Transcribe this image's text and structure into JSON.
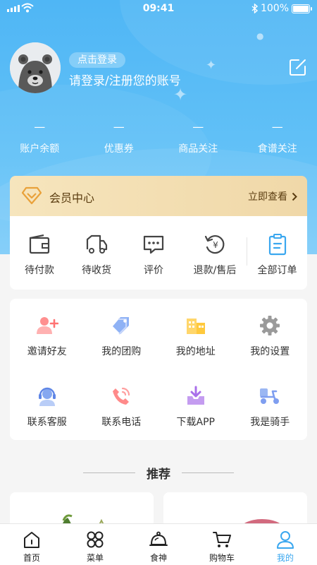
{
  "status_bar": {
    "time": "09:41",
    "battery": "100%"
  },
  "profile": {
    "login_button": "点击登录",
    "login_prompt": "请登录/注册您的账号"
  },
  "stats": [
    {
      "value": "—",
      "label": "账户余额"
    },
    {
      "value": "—",
      "label": "优惠券"
    },
    {
      "value": "—",
      "label": "商品关注"
    },
    {
      "value": "—",
      "label": "食谱关注"
    }
  ],
  "vip": {
    "title": "会员中心",
    "action": "立即查看"
  },
  "orders": [
    {
      "label": "待付款",
      "icon": "wallet-icon"
    },
    {
      "label": "待收货",
      "icon": "truck-icon"
    },
    {
      "label": "评价",
      "icon": "comment-icon"
    },
    {
      "label": "退款/售后",
      "icon": "refund-icon"
    },
    {
      "label": "全部订单",
      "icon": "clipboard-icon"
    }
  ],
  "services": [
    {
      "label": "邀请好友",
      "icon": "invite-friend-icon"
    },
    {
      "label": "我的团购",
      "icon": "group-buy-tag-icon"
    },
    {
      "label": "我的地址",
      "icon": "address-building-icon"
    },
    {
      "label": "我的设置",
      "icon": "settings-gear-icon"
    },
    {
      "label": "联系客服",
      "icon": "customer-service-icon"
    },
    {
      "label": "联系电话",
      "icon": "phone-icon"
    },
    {
      "label": "下载APP",
      "icon": "download-icon"
    },
    {
      "label": "我是骑手",
      "icon": "rider-scooter-icon"
    }
  ],
  "recommend": {
    "title": "推荐"
  },
  "tabbar": [
    {
      "label": "首页",
      "icon": "home-icon"
    },
    {
      "label": "菜单",
      "icon": "menu-grid-icon"
    },
    {
      "label": "食神",
      "icon": "chef-cloche-icon"
    },
    {
      "label": "购物车",
      "icon": "cart-icon"
    },
    {
      "label": "我的",
      "icon": "user-icon",
      "active": true
    }
  ],
  "colors": {
    "accent": "#3aa7ef",
    "hero": "#56b9f5",
    "vip_bg": "#f3deb2",
    "vip_text": "#5a3c10"
  }
}
